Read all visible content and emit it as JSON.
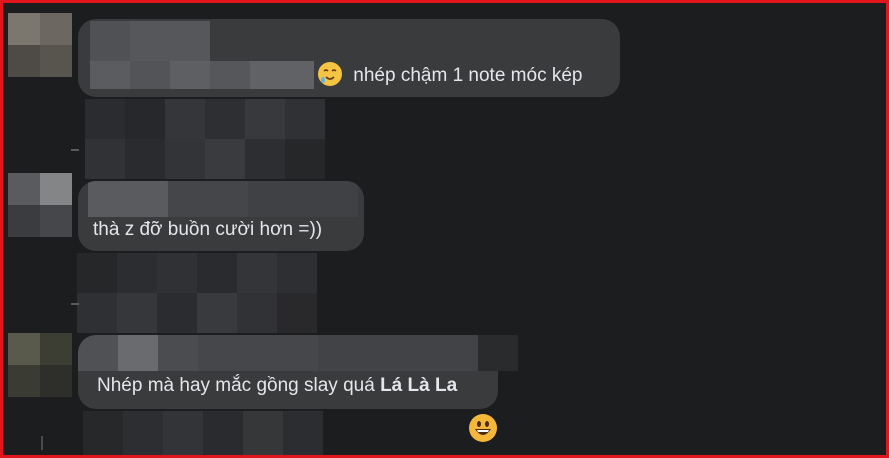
{
  "messages": [
    {
      "text": "nhép chậm 1 note móc kép",
      "emoji": "crying-smiling-face"
    },
    {
      "text": "thà z đỡ buồn cười hơn =))"
    },
    {
      "text_prefix": "Nhép mà hay mắc gồng slay quá ",
      "text_bold": "Lá Là La",
      "reaction": "grinning-face"
    }
  ],
  "colors": {
    "background": "#1c1d1f",
    "bubble": "#3a3b3c",
    "text": "#e4e6eb",
    "frame": "#e0161c"
  }
}
